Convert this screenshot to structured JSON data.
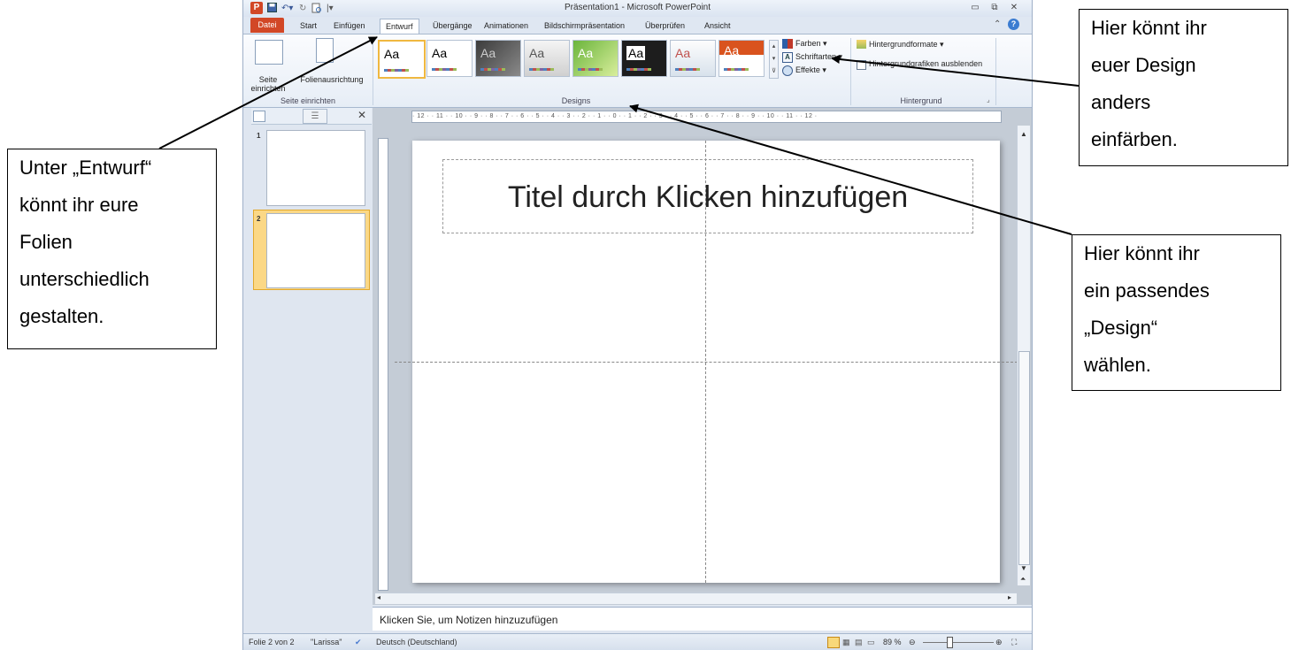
{
  "titlebar": {
    "title": "Präsentation1 - Microsoft PowerPoint",
    "app_icon": "P",
    "qa_icons": [
      "save-icon",
      "undo-icon",
      "redo-icon",
      "print-preview-icon"
    ],
    "controls": {
      "minimize": "▭",
      "restore": "⧉",
      "close": "✕"
    }
  },
  "tabs": [
    "Datei",
    "Start",
    "Einfügen",
    "Entwurf",
    "Übergänge",
    "Animationen",
    "Bildschirmpräsentation",
    "Überprüfen",
    "Ansicht"
  ],
  "ribbon": {
    "page_setup": {
      "seite": "Seite einrichten",
      "ausrichtung": "Folienausrichtung",
      "group": "Seite einrichten"
    },
    "designs_group": "Designs",
    "theme_label": "Aa",
    "options": {
      "farben": "Farben",
      "schriftarten": "Schriftarten",
      "effekte": "Effekte"
    },
    "background": {
      "formate": "Hintergrundformate",
      "ausblenden": "Hintergrundgrafiken ausblenden",
      "group": "Hintergrund"
    }
  },
  "slides_pane": {
    "slide1": "1",
    "slide2": "2"
  },
  "ruler": "· 12 · · 11 · · 10 · · 9 · · 8 · · 7 · · 6 · · 5 · · 4 · · 3 · · 2 · · 1 · · 0 · · 1 · · 2 · · 3 · · 4 · · 5 · · 6 · · 7 · · 8 · · 9 · · 10 · · 11 · · 12 ·",
  "slide": {
    "title_placeholder": "Titel durch Klicken hinzufügen"
  },
  "notes": {
    "placeholder": "Klicken Sie, um Notizen hinzuzufügen"
  },
  "status": {
    "slide": "Folie 2 von 2",
    "theme": "\"Larissa\"",
    "language": "Deutsch (Deutschland)",
    "zoom": "89 %"
  },
  "callouts": {
    "left": [
      "Unter „Entwurf“",
      "könnt ihr eure",
      "Folien",
      "unterschiedlich",
      "gestalten."
    ],
    "top_right": [
      "Hier könnt ihr",
      "euer Design",
      "anders",
      "einfärben."
    ],
    "right": [
      "Hier könnt ihr",
      "ein passendes",
      "„Design“",
      "wählen."
    ]
  },
  "colors": {
    "accent": "#d24726",
    "ribbon_border": "#a7b8ce",
    "selected_slide": "#f7c95b"
  }
}
